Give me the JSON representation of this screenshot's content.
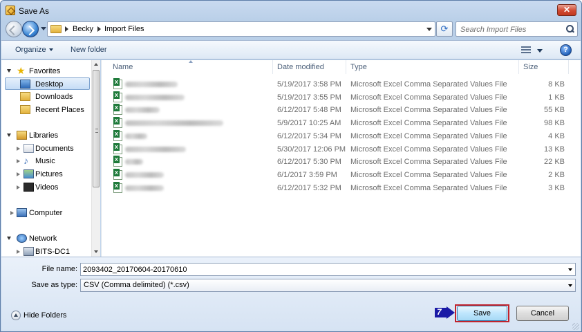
{
  "window": {
    "title": "Save As"
  },
  "address": {
    "crumbs": [
      "Becky",
      "Import Files"
    ]
  },
  "search": {
    "placeholder": "Search Import Files"
  },
  "toolbar": {
    "organize_label": "Organize",
    "new_folder_label": "New folder"
  },
  "nav": {
    "favorites": "Favorites",
    "desktop": "Desktop",
    "downloads": "Downloads",
    "recent": "Recent Places",
    "libraries": "Libraries",
    "documents": "Documents",
    "music": "Music",
    "pictures": "Pictures",
    "videos": "Videos",
    "computer": "Computer",
    "network": "Network",
    "server": "BITS-DC1"
  },
  "columns": {
    "name": "Name",
    "date": "Date modified",
    "type": "Type",
    "size": "Size"
  },
  "files": [
    {
      "date": "5/19/2017 3:58 PM",
      "type": "Microsoft Excel Comma Separated Values File",
      "size": "8 KB"
    },
    {
      "date": "5/19/2017 3:55 PM",
      "type": "Microsoft Excel Comma Separated Values File",
      "size": "1 KB"
    },
    {
      "date": "6/12/2017 5:48 PM",
      "type": "Microsoft Excel Comma Separated Values File",
      "size": "55 KB"
    },
    {
      "date": "5/9/2017 10:25 AM",
      "type": "Microsoft Excel Comma Separated Values File",
      "size": "98 KB"
    },
    {
      "date": "6/12/2017 5:34 PM",
      "type": "Microsoft Excel Comma Separated Values File",
      "size": "4 KB"
    },
    {
      "date": "5/30/2017 12:06 PM",
      "type": "Microsoft Excel Comma Separated Values File",
      "size": "13 KB"
    },
    {
      "date": "6/12/2017 5:30 PM",
      "type": "Microsoft Excel Comma Separated Values File",
      "size": "22 KB"
    },
    {
      "date": "6/1/2017 3:59 PM",
      "type": "Microsoft Excel Comma Separated Values File",
      "size": "2 KB"
    },
    {
      "date": "6/12/2017 5:32 PM",
      "type": "Microsoft Excel Comma Separated Values File",
      "size": "3 KB"
    }
  ],
  "form": {
    "filename_label": "File name:",
    "filename_value": "2093402_20170604-20170610",
    "savetype_label": "Save as type:",
    "savetype_value": "CSV (Comma delimited) (*.csv)"
  },
  "footer": {
    "hide_folders_label": "Hide Folders",
    "step_number": "7",
    "save_label": "Save",
    "cancel_label": "Cancel"
  }
}
